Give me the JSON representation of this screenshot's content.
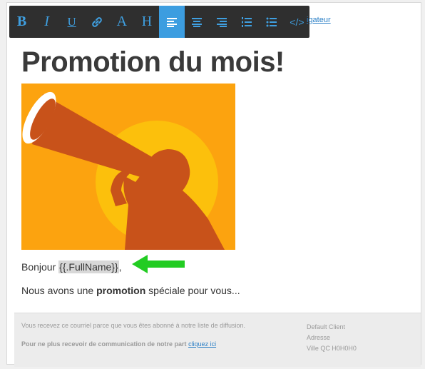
{
  "toolbar": {
    "buttons": [
      {
        "label": "B",
        "icon": "bold-icon"
      },
      {
        "label": "I",
        "icon": "italic-icon"
      },
      {
        "label": "U",
        "icon": "underline-icon"
      },
      {
        "label": "",
        "icon": "link-icon"
      },
      {
        "label": "A",
        "icon": "font-color-icon"
      },
      {
        "label": "H",
        "icon": "heading-icon"
      },
      {
        "label": "",
        "icon": "align-left-icon",
        "active": true
      },
      {
        "label": "",
        "icon": "align-center-icon"
      },
      {
        "label": "",
        "icon": "align-right-icon"
      },
      {
        "label": "",
        "icon": "ordered-list-icon"
      },
      {
        "label": "",
        "icon": "unordered-list-icon"
      },
      {
        "label": "</>",
        "icon": "code-icon"
      }
    ],
    "active_color": "#3c9de0",
    "icon_color": "#3f9fe0"
  },
  "browser_link": "igateur",
  "email": {
    "title": "Promotion du mois!",
    "greeting_prefix": "Bonjour ",
    "name_token": "{{.FullName}}",
    "greeting_suffix": ",",
    "body_prefix": "Nous avons une ",
    "body_bold": "promotion",
    "body_suffix": " spéciale pour vous..."
  },
  "footer": {
    "notice": "Vous recevez ce courriel parce que vous êtes abonné à notre liste de diffusion.",
    "unsubscribe_text": "Pour ne plus recevoir de communication de notre part ",
    "unsubscribe_link": "cliquez ici",
    "address_lines": [
      "Default Client",
      "Adresse",
      "Ville QC H0H0H0"
    ]
  },
  "annotation": {
    "arrow_color": "#22cc22"
  }
}
